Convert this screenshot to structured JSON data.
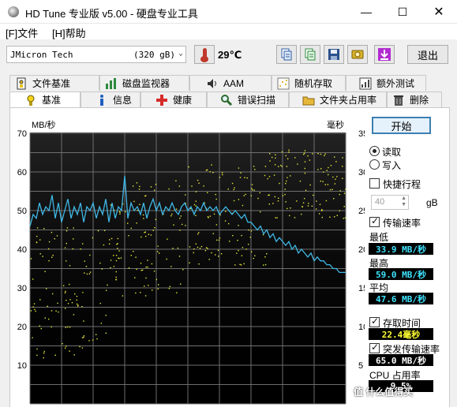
{
  "window": {
    "title": "HD Tune 专业版 v5.00 - 硬盘专业工具",
    "min_glyph": "—",
    "max_glyph": "☐",
    "close_glyph": "✕"
  },
  "menu": {
    "file": "[F]文件",
    "help": "[H]帮助"
  },
  "toolbar": {
    "drive_name": "JMicron Tech",
    "drive_size": "(320 gB)",
    "temperature": "29℃",
    "exit_label": "退出",
    "icons": [
      "copy-icon",
      "copy-all-icon",
      "save-icon",
      "screenshot-icon",
      "download-icon"
    ]
  },
  "tabs_row1": [
    {
      "label": "文件基准",
      "icon": "file-benchmark-icon"
    },
    {
      "label": "磁盘监视器",
      "icon": "disk-monitor-icon"
    },
    {
      "label": "AAM",
      "icon": "speaker-icon"
    },
    {
      "label": "随机存取",
      "icon": "random-access-icon"
    },
    {
      "label": "额外测试",
      "icon": "extra-tests-icon"
    }
  ],
  "tabs_row2": [
    {
      "label": "基准",
      "icon": "benchmark-icon",
      "active": true
    },
    {
      "label": "信息",
      "icon": "info-icon",
      "active": false
    },
    {
      "label": "健康",
      "icon": "health-icon",
      "active": false
    },
    {
      "label": "错误扫描",
      "icon": "error-scan-icon",
      "active": false
    },
    {
      "label": "文件夹占用率",
      "icon": "folder-usage-icon",
      "active": false
    },
    {
      "label": "删除",
      "icon": "erase-icon",
      "active": false
    }
  ],
  "controls": {
    "start_label": "开始",
    "read_label": "读取",
    "write_label": "写入",
    "read_selected": true,
    "short_stroke_label": "快捷行程",
    "short_stroke_checked": false,
    "stroke_value": "40",
    "stroke_unit": "gB",
    "transfer_rate_label": "传输速率",
    "transfer_rate_checked": true,
    "min_label": "最低",
    "min_value": "33.9 MB/秒",
    "max_label": "最高",
    "max_value": "59.0 MB/秒",
    "avg_label": "平均",
    "avg_value": "47.6 MB/秒",
    "access_time_label": "存取时间",
    "access_time_checked": true,
    "access_time_value": "22.4毫秒",
    "burst_label": "突发传输速率",
    "burst_checked": true,
    "burst_value": "65.0 MB/秒",
    "cpu_label": "CPU 占用率",
    "cpu_value": "9.5%"
  },
  "watermark": "值 什么值得买",
  "chart_data": {
    "type": "line",
    "left_unit": "MB/秒",
    "right_unit": "毫秒",
    "y_left_ticks": [
      70,
      60,
      50,
      40,
      30,
      20,
      10
    ],
    "y_right_ticks": [
      35,
      30,
      25,
      20,
      15,
      10,
      5
    ],
    "ylim_left": [
      0,
      70
    ],
    "ylim_right": [
      0,
      35
    ],
    "grid": true,
    "colors": {
      "background": "#000000",
      "grid": "#6e6e6e",
      "transfer_line": "#3fb7e6",
      "access_points": "#e8e83a"
    },
    "series": [
      {
        "name": "传输速率",
        "axis": "left",
        "x": [
          0,
          1,
          2,
          3,
          4,
          5,
          6,
          7,
          8,
          9,
          10,
          11,
          12,
          13,
          14,
          15,
          16,
          17,
          18,
          19,
          20,
          21,
          22,
          23,
          24,
          25,
          26,
          27,
          28,
          29,
          30,
          31,
          32,
          33,
          34,
          35,
          36,
          37,
          38,
          39,
          40,
          41,
          42,
          43,
          44,
          45,
          46,
          47,
          48,
          49,
          50,
          51,
          52,
          53,
          54,
          55,
          56,
          57,
          58,
          59,
          60,
          61,
          62,
          63,
          64,
          65,
          66,
          67,
          68,
          69,
          70,
          71,
          72,
          73,
          74,
          75,
          76,
          77,
          78,
          79,
          80,
          81,
          82,
          83,
          84,
          85,
          86,
          87,
          88,
          89,
          90,
          91,
          92,
          93,
          94,
          95,
          96,
          97,
          98,
          99,
          100
        ],
        "values": [
          46,
          49,
          48,
          52,
          49,
          51,
          50,
          54,
          48,
          52,
          47,
          50,
          53,
          48,
          51,
          49,
          52,
          47,
          51,
          50,
          52,
          48,
          51,
          49,
          53,
          47,
          52,
          48,
          51,
          50,
          59,
          48,
          52,
          50,
          51,
          49,
          52,
          48,
          51,
          53,
          50,
          52,
          49,
          51,
          50,
          52,
          50,
          49,
          51,
          52,
          50,
          51,
          49,
          51,
          50,
          52,
          50,
          51,
          50,
          51,
          49,
          50,
          51,
          50,
          49,
          50,
          49,
          48,
          49,
          47,
          47,
          46,
          45,
          46,
          44,
          45,
          43,
          44,
          42,
          43,
          42,
          41,
          42,
          40,
          41,
          39,
          40,
          39,
          38,
          39,
          37,
          38,
          37,
          37,
          36,
          36,
          35,
          35,
          34,
          34,
          34
        ]
      },
      {
        "name": "存取时间",
        "axis": "right",
        "marker": "point",
        "clusters": [
          {
            "x_range": [
              0,
              25
            ],
            "ms_range": [
              6,
              23
            ]
          },
          {
            "x_range": [
              25,
              50
            ],
            "ms_range": [
              14,
              29
            ]
          },
          {
            "x_range": [
              50,
              75
            ],
            "ms_range": [
              18,
              31
            ]
          },
          {
            "x_range": [
              75,
              100
            ],
            "ms_range": [
              24,
              33
            ]
          }
        ]
      }
    ]
  }
}
